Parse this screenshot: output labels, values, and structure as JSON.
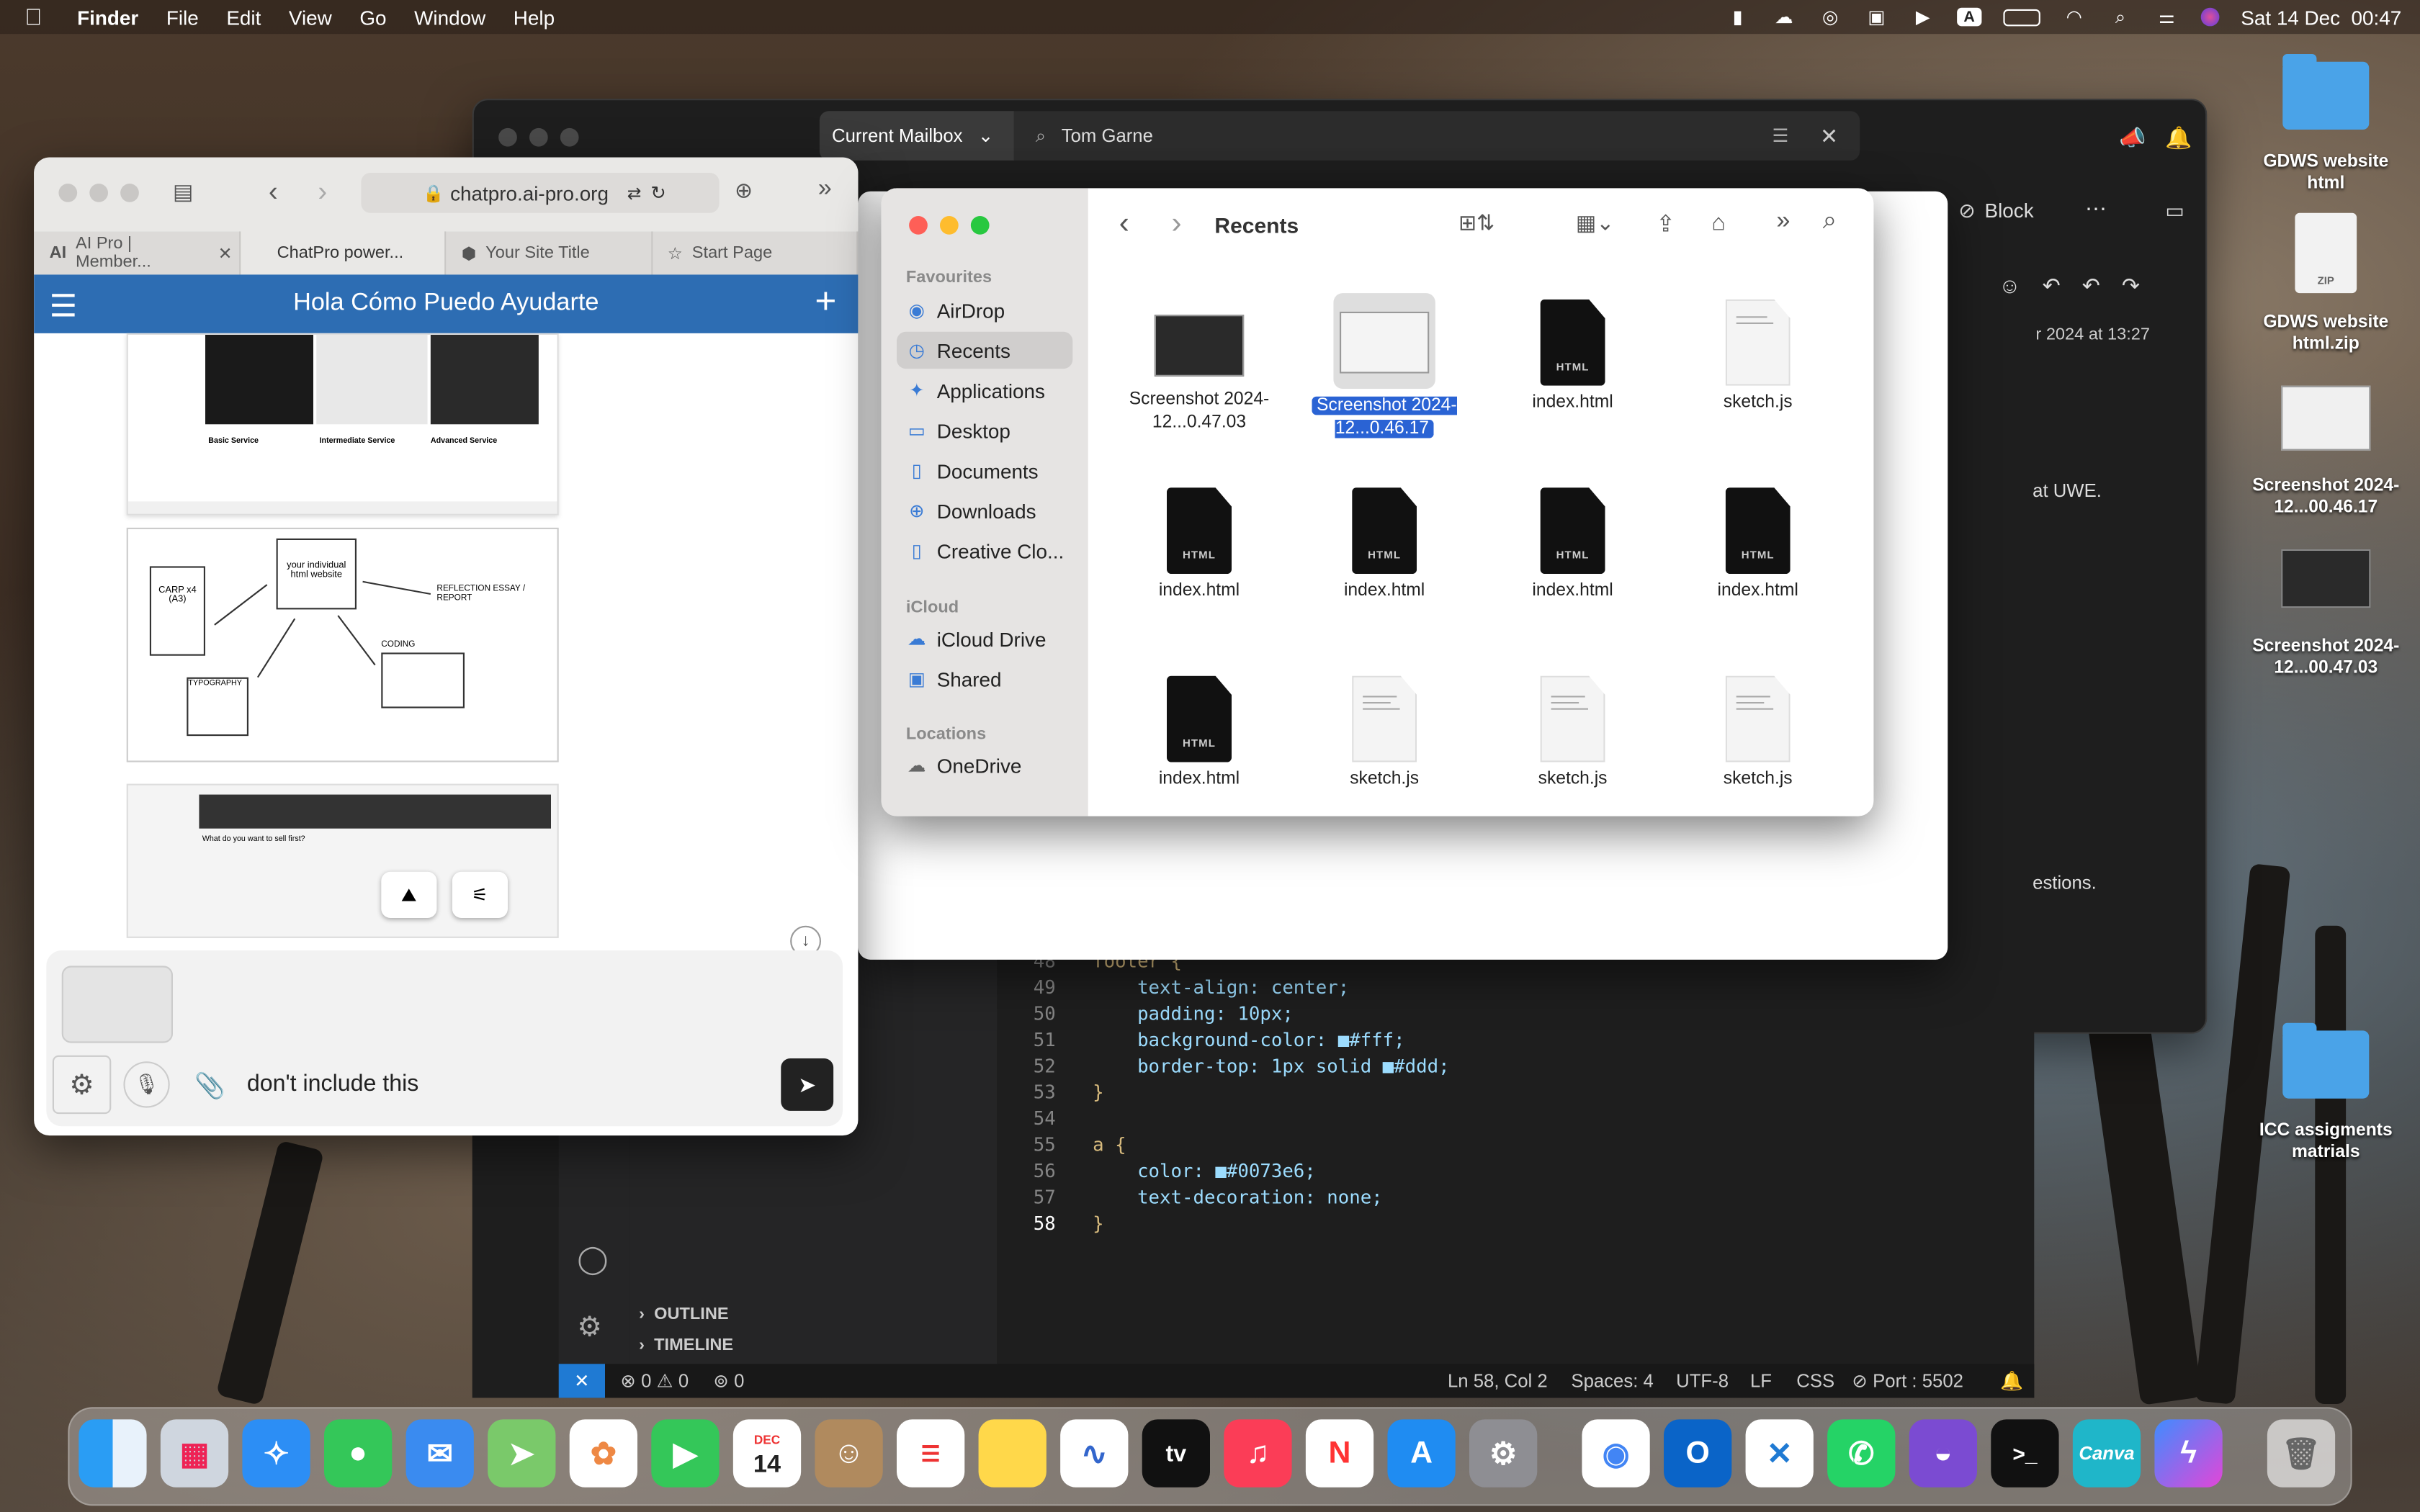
{
  "menubar": {
    "app": "Finder",
    "items": [
      "File",
      "Edit",
      "View",
      "Go",
      "Window",
      "Help"
    ],
    "input_indicator": "A",
    "clock": "Sat 14 Dec  00:47"
  },
  "mail": {
    "scope_label": "Current Mailbox",
    "search_value": "Tom Garne",
    "block_label": "Block",
    "date_text": "r 2024 at 13:27",
    "body_line_1": "at UWE.",
    "body_line_2": "estions."
  },
  "vscode": {
    "code_lines": [
      {
        "n": "48",
        "t": "footer {"
      },
      {
        "n": "49",
        "t": "    text-align: center;"
      },
      {
        "n": "50",
        "t": "    padding: 10px;"
      },
      {
        "n": "51",
        "t": "    background-color: ■#fff;"
      },
      {
        "n": "52",
        "t": "    border-top: 1px solid ■#ddd;"
      },
      {
        "n": "53",
        "t": "}"
      },
      {
        "n": "54",
        "t": ""
      },
      {
        "n": "55",
        "t": "a {"
      },
      {
        "n": "56",
        "t": "    color: ■#0073e6;"
      },
      {
        "n": "57",
        "t": "    text-decoration: none;"
      },
      {
        "n": "58",
        "t": "}"
      }
    ],
    "outline": "OUTLINE",
    "timeline": "TIMELINE",
    "status_errors": "0",
    "status_warnings": "0",
    "status_ports": "0",
    "status_pos": "Ln 58, Col 2",
    "status_spaces": "Spaces: 4",
    "status_enc": "UTF-8",
    "status_eol": "LF",
    "status_lang": "CSS",
    "status_port": "Port : 5502"
  },
  "browser": {
    "url": "chatpro.ai-pro.org",
    "tabs": [
      "AI Pro | Member...",
      "ChatPro power...",
      "Your Site Title",
      "Start Page"
    ],
    "header_title": "Hola Cómo Puedo Ayudarte",
    "services": [
      "Basic Service",
      "Intermediate Service",
      "Advanced Service"
    ],
    "diagram": {
      "carp": "CARP x4 (A3)",
      "center": "your individual html website",
      "reflection": "REFLECTION ESSAY / REPORT",
      "coding": "CODING",
      "typography": "TYPOGRAPHY"
    },
    "preview_heading": "What do you want to sell first?",
    "input_text": "don't include this"
  },
  "finder": {
    "title": "Recents",
    "sidebar": {
      "favourites_header": "Favourites",
      "favourites": [
        "AirDrop",
        "Recents",
        "Applications",
        "Desktop",
        "Documents",
        "Downloads",
        "Creative Clo..."
      ],
      "icloud_header": "iCloud",
      "icloud": [
        "iCloud Drive",
        "Shared"
      ],
      "locations_header": "Locations",
      "locations": [
        "OneDrive"
      ]
    },
    "files": [
      {
        "name": "Screenshot 2024-12...0.47.03",
        "kind": "screenshot"
      },
      {
        "name": "Screenshot 2024-12...0.46.17",
        "kind": "screenshot-selected"
      },
      {
        "name": "index.html",
        "kind": "html"
      },
      {
        "name": "sketch.js",
        "kind": "js"
      },
      {
        "name": "index.html",
        "kind": "html"
      },
      {
        "name": "index.html",
        "kind": "html"
      },
      {
        "name": "index.html",
        "kind": "html"
      },
      {
        "name": "index.html",
        "kind": "html"
      },
      {
        "name": "index.html",
        "kind": "html"
      },
      {
        "name": "sketch.js",
        "kind": "js"
      },
      {
        "name": "sketch.js",
        "kind": "js"
      },
      {
        "name": "sketch.js",
        "kind": "js"
      }
    ]
  },
  "desktop": [
    {
      "name": "GDWS website html",
      "kind": "folder"
    },
    {
      "name": "GDWS website html.zip",
      "kind": "zip"
    },
    {
      "name": "Screenshot 2024-12...00.46.17",
      "kind": "screenshot"
    },
    {
      "name": "Screenshot 2024-12...00.47.03",
      "kind": "screenshot"
    },
    {
      "name": "ICC assigments matrials",
      "kind": "folder"
    }
  ],
  "dock": {
    "calendar_month": "DEC",
    "calendar_day": "14",
    "tv_label": "tv",
    "canva_label": "Canva",
    "apps": [
      "finder-icon",
      "launchpad-icon",
      "safari-icon",
      "messages-icon",
      "mail-icon",
      "maps-icon",
      "photos-icon",
      "facetime-icon",
      "calendar-icon",
      "contacts-icon",
      "reminders-icon",
      "notes-icon",
      "freeform-icon",
      "tv-icon",
      "music-icon",
      "news-icon",
      "app-store-icon",
      "settings-icon",
      "chrome-icon",
      "outlook-icon",
      "vscode-icon",
      "whatsapp-icon",
      "github-icon",
      "terminal-icon",
      "canva-icon",
      "messenger-icon",
      "trash-icon"
    ]
  }
}
